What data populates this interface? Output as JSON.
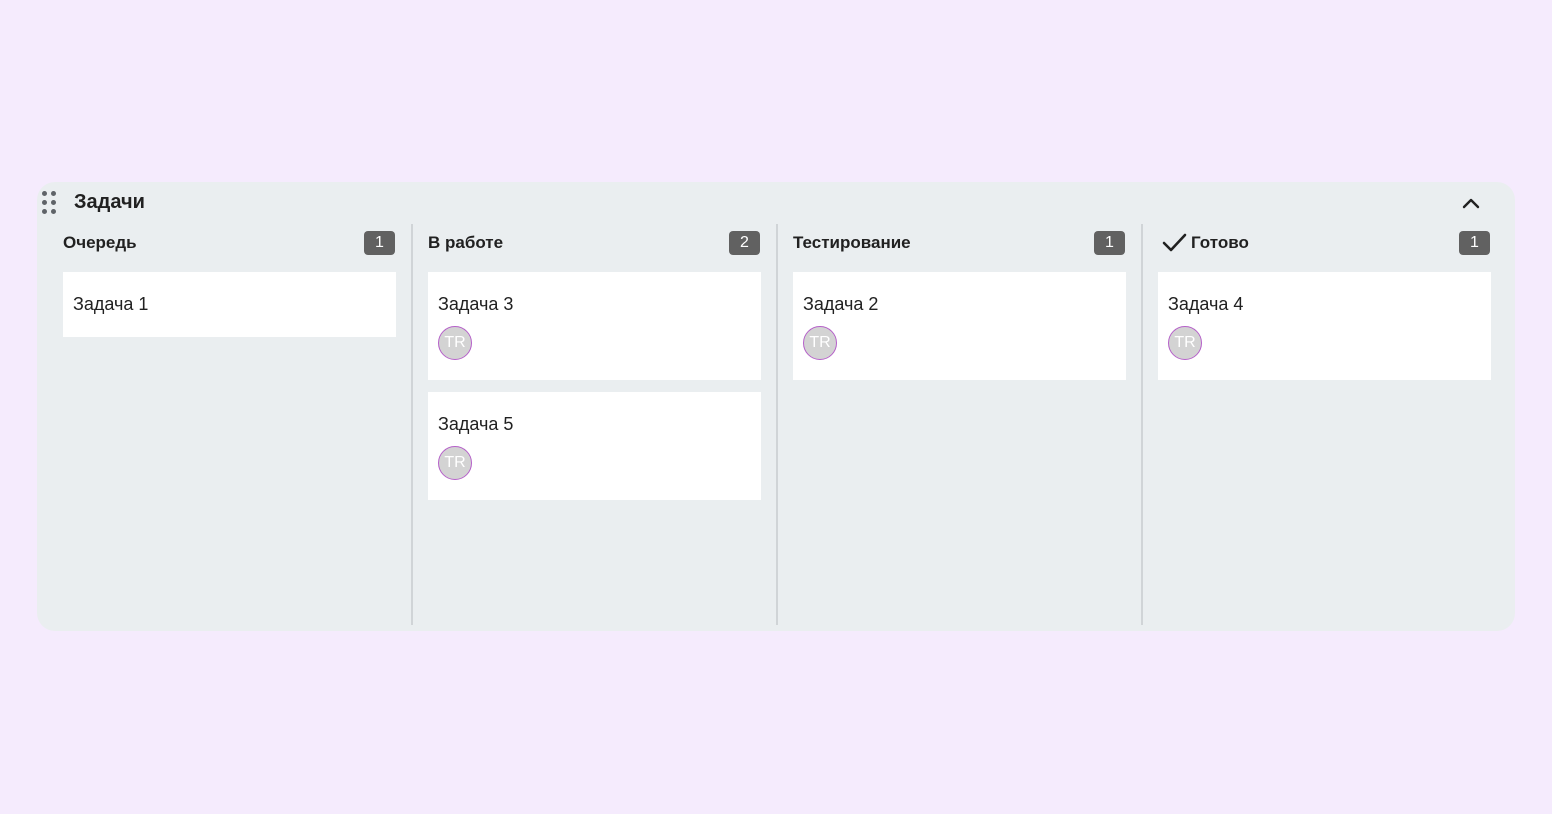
{
  "panel": {
    "title": "Задачи",
    "icons": {
      "drag": "drag-handle-icon",
      "collapse": "chevron-up-icon"
    }
  },
  "columns": [
    {
      "title": "Очередь",
      "count": "1",
      "cards": [
        {
          "title": "Задача 1",
          "assignee": null
        }
      ]
    },
    {
      "title": "В работе",
      "count": "2",
      "cards": [
        {
          "title": "Задача 3",
          "assignee": "TR"
        },
        {
          "title": "Задача 5",
          "assignee": "TR"
        }
      ]
    },
    {
      "title": "Тестирование",
      "count": "1",
      "cards": [
        {
          "title": "Задача 2",
          "assignee": "TR"
        }
      ]
    },
    {
      "title": "Готово",
      "icon": "checkmark-icon",
      "count": "1",
      "cards": [
        {
          "title": "Задача 4",
          "assignee": "TR"
        }
      ]
    }
  ],
  "colors": {
    "page_background": "#f5ebfd",
    "panel_background": "#eaeef0",
    "badge_background": "#616161",
    "avatar_background": "#d3d3d3",
    "avatar_border": "#b560c9"
  }
}
